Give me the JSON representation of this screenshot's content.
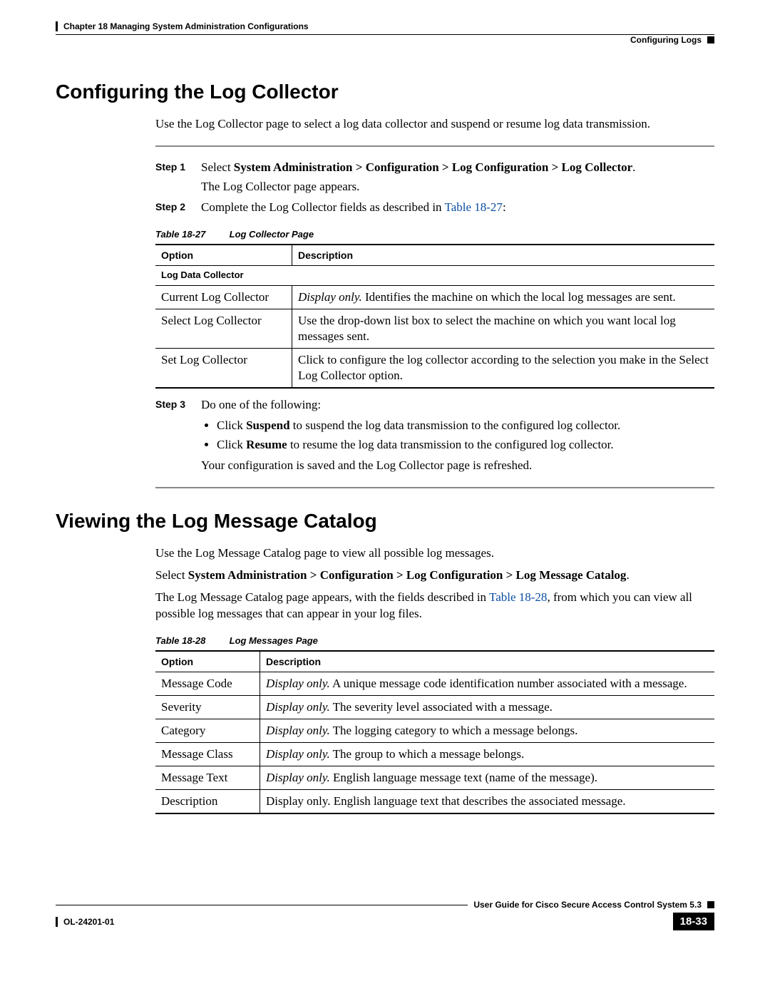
{
  "header": {
    "chapter_line": "Chapter 18    Managing System Administration Configurations",
    "right_label": "Configuring Logs"
  },
  "section1": {
    "title": "Configuring the Log Collector",
    "intro": "Use the Log Collector page to select a log data collector and suspend or resume log data transmission.",
    "step1_label": "Step 1",
    "step1_prefix": "Select ",
    "step1_bold": "System Administration > Configuration > Log Configuration > Log Collector",
    "step1_suffix": ".",
    "step1_sub": "The Log Collector page appears.",
    "step2_label": "Step 2",
    "step2_prefix": "Complete the Log Collector fields as described in ",
    "step2_link": "Table 18-27",
    "step2_suffix": ":",
    "table_caption_label": "Table 18-27",
    "table_caption_title": "Log Collector Page",
    "th_option": "Option",
    "th_desc": "Description",
    "subhead": "Log Data Collector",
    "rows": [
      {
        "opt": "Current Log Collector",
        "desc_em": "Display only.",
        "desc": " Identifies the machine on which the local log messages are sent."
      },
      {
        "opt": "Select Log Collector",
        "desc_em": "",
        "desc": "Use the drop-down list box to select the machine on which you want local log messages sent."
      },
      {
        "opt": "Set Log Collector",
        "desc_em": "",
        "desc": "Click to configure the log collector according to the selection you make in the Select Log Collector option."
      }
    ],
    "step3_label": "Step 3",
    "step3_text": "Do one of the following:",
    "bullet1_pre": "Click ",
    "bullet1_bold": "Suspend",
    "bullet1_post": " to suspend the log data transmission to the configured log collector.",
    "bullet2_pre": "Click ",
    "bullet2_bold": "Resume",
    "bullet2_post": " to resume the log data transmission to the configured log collector.",
    "step3_after": "Your configuration is saved and the Log Collector page is refreshed."
  },
  "section2": {
    "title": "Viewing the Log Message Catalog",
    "intro": "Use the Log Message Catalog page to view all possible log messages.",
    "sel_prefix": "Select ",
    "sel_bold": "System Administration > Configuration > Log Configuration > Log Message Catalog",
    "sel_suffix": ".",
    "appears_pre": "The Log Message Catalog page appears, with the fields described in ",
    "appears_link": "Table 18-28",
    "appears_post": ", from which you can view all possible log messages that can appear in your log files.",
    "table_caption_label": "Table 18-28",
    "table_caption_title": "Log Messages Page",
    "th_option": "Option",
    "th_desc": "Description",
    "rows": [
      {
        "opt": "Message Code",
        "desc_em": "Display only.",
        "desc": " A unique message code identification number associated with a message."
      },
      {
        "opt": "Severity",
        "desc_em": "Display only.",
        "desc": " The severity level associated with a message."
      },
      {
        "opt": "Category",
        "desc_em": "Display only.",
        "desc": " The logging category to which a message belongs."
      },
      {
        "opt": "Message Class",
        "desc_em": "Display only.",
        "desc": " The group to which a message belongs."
      },
      {
        "opt": "Message Text",
        "desc_em": "Display only.",
        "desc": " English language message text (name of the message)."
      },
      {
        "opt": "Description",
        "desc_em": "",
        "desc": "Display only. English language text that describes the associated message."
      }
    ]
  },
  "footer": {
    "guide": "User Guide for Cisco Secure Access Control System 5.3",
    "doc_id": "OL-24201-01",
    "page_num": "18-33"
  }
}
